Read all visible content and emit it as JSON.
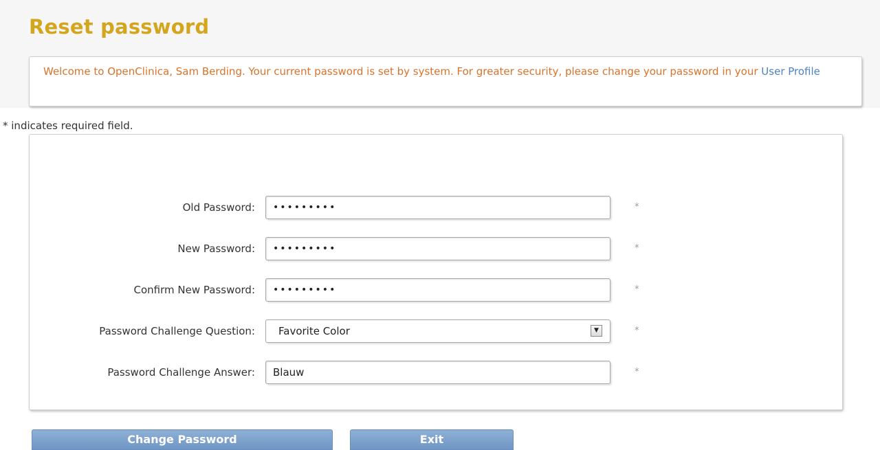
{
  "page": {
    "title": "Reset password"
  },
  "notice": {
    "message": "Welcome to OpenClinica, Sam Berding. Your current password is set by system. For greater security, please change your password in your ",
    "link_text": "User Profile"
  },
  "required_note": "* indicates required field.",
  "form": {
    "required_marker": "*",
    "old_password": {
      "label": "Old Password:",
      "value": "•••••••••"
    },
    "new_password": {
      "label": "New Password:",
      "value": "•••••••••"
    },
    "confirm_password": {
      "label": "Confirm New Password:",
      "value": "•••••••••"
    },
    "challenge_question": {
      "label": "Password Challenge Question:",
      "value": "Favorite Color",
      "arrow_icon": "dropdown-arrow-icon"
    },
    "challenge_answer": {
      "label": "Password Challenge Answer:",
      "value": "Blauw"
    }
  },
  "buttons": {
    "change_password": "Change Password",
    "exit": "Exit"
  },
  "colors": {
    "title": "#d4a61e",
    "notice_text": "#d9732b",
    "link": "#4e82c3",
    "button": "#7ea2cd"
  }
}
